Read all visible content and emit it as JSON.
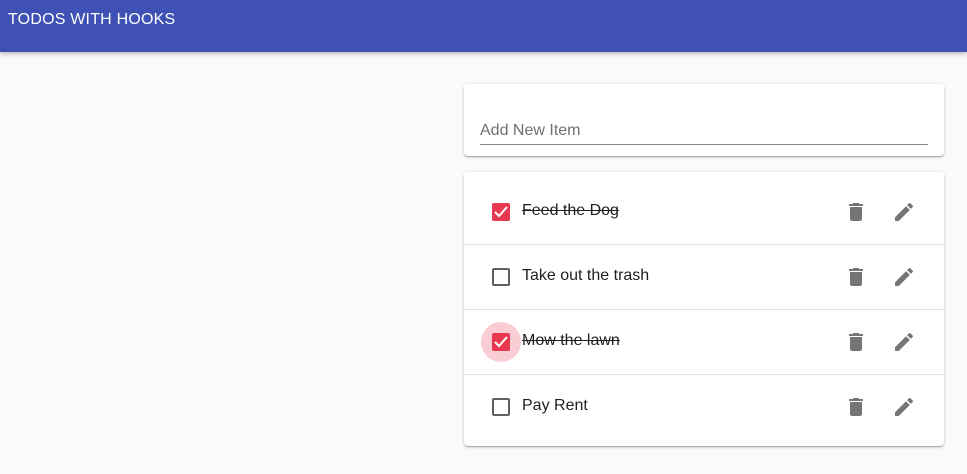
{
  "app": {
    "title": "TODOS WITH HOOKS"
  },
  "add_item": {
    "placeholder": "Add New Item",
    "value": ""
  },
  "todos": [
    {
      "label": "Feed the Dog",
      "completed": true
    },
    {
      "label": "Take out the trash",
      "completed": false
    },
    {
      "label": "Mow the lawn",
      "completed": true,
      "focused": true
    },
    {
      "label": "Pay Rent",
      "completed": false
    }
  ],
  "colors": {
    "appbar": "#3f51b5",
    "checkbox_checked": "#e8384f",
    "icon": "#757575"
  },
  "icons": {
    "delete": "trash-icon",
    "edit": "pencil-icon",
    "check": "checkmark-icon"
  }
}
